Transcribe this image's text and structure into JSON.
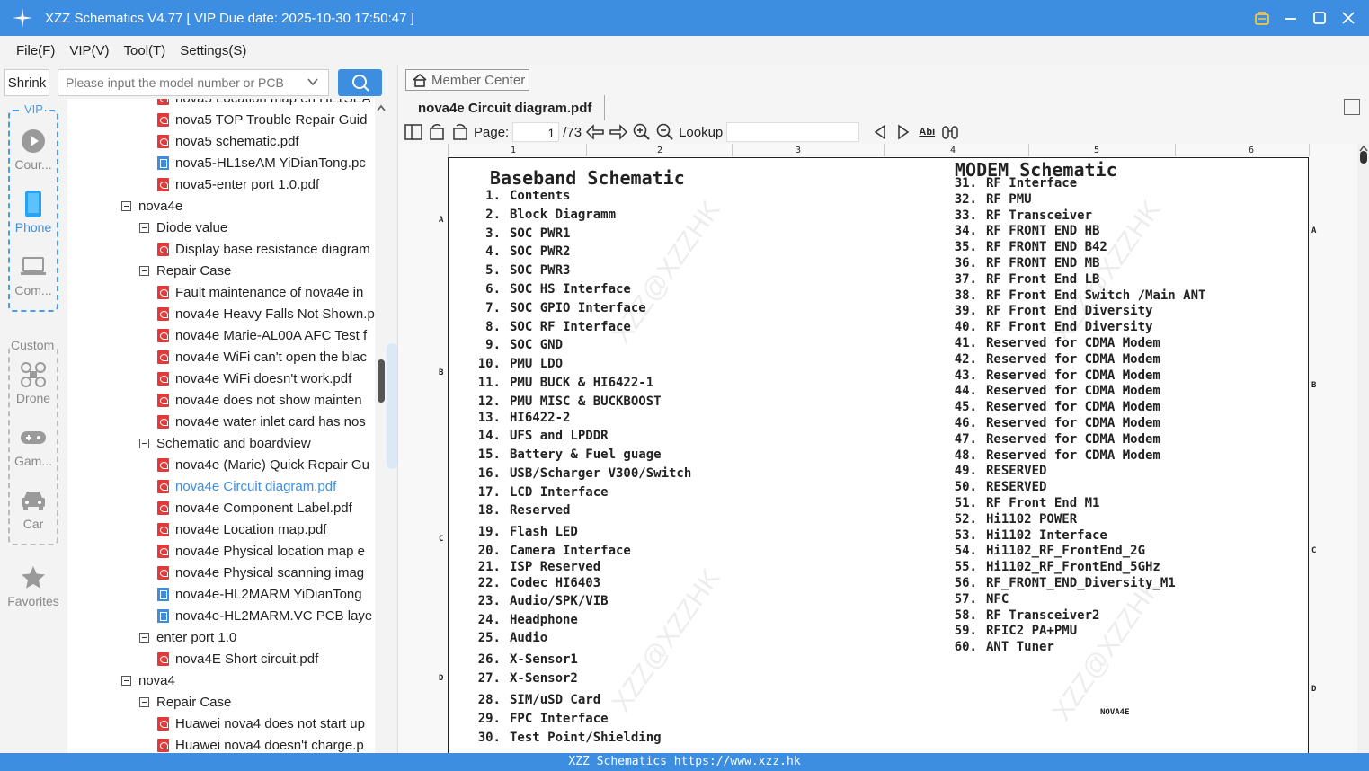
{
  "window": {
    "title": "XZZ Schematics V4.77 [ VIP Due date: 2025-10-30 17:50:47 ]"
  },
  "menu": [
    "File(F)",
    "VIP(V)",
    "Tool(T)",
    "Settings(S)"
  ],
  "left": {
    "shrink_label": "Shrink",
    "search_placeholder": "Please input the model number or PCB"
  },
  "sidebar": {
    "vip_caption": "VIP",
    "custom_caption": "Custom",
    "items": [
      {
        "label": "Cour...",
        "icon": "play-icon"
      },
      {
        "label": "Phone",
        "icon": "phone-icon"
      },
      {
        "label": "Com...",
        "icon": "laptop-icon"
      },
      {
        "label": "Drone",
        "icon": "drone-icon"
      },
      {
        "label": "Gam...",
        "icon": "gamepad-icon"
      },
      {
        "label": "Car",
        "icon": "car-icon"
      },
      {
        "label": "Favorites",
        "icon": "star-icon"
      }
    ]
  },
  "tree": [
    {
      "label": "nova5 Location map en HL1SEA",
      "type": "pdf",
      "level": 3
    },
    {
      "label": "nova5 TOP Trouble Repair Guid",
      "type": "pdf",
      "level": 3
    },
    {
      "label": "nova5 schematic.pdf",
      "type": "pdf",
      "level": 3
    },
    {
      "label": "nova5-HL1seAM YiDianTong.pc",
      "type": "pcb",
      "level": 3
    },
    {
      "label": "nova5-enter port 1.0.pdf",
      "type": "pdf",
      "level": 3
    },
    {
      "label": "nova4e",
      "type": "folder",
      "level": 1
    },
    {
      "label": "Diode value",
      "type": "folder",
      "level": 2
    },
    {
      "label": "Display base resistance diagram",
      "type": "pdf",
      "level": 3
    },
    {
      "label": "Repair Case",
      "type": "folder",
      "level": 2
    },
    {
      "label": "Fault maintenance of nova4e in",
      "type": "pdf",
      "level": 3
    },
    {
      "label": "nova4e Heavy Falls Not Shown.p",
      "type": "pdf",
      "level": 3
    },
    {
      "label": "nova4e Marie-AL00A AFC Test f",
      "type": "pdf",
      "level": 3
    },
    {
      "label": "nova4e WiFi can't open the blac",
      "type": "pdf",
      "level": 3
    },
    {
      "label": "nova4e WiFi doesn't work.pdf",
      "type": "pdf",
      "level": 3
    },
    {
      "label": "nova4e does not show mainten",
      "type": "pdf",
      "level": 3
    },
    {
      "label": "nova4e water inlet card has nos",
      "type": "pdf",
      "level": 3
    },
    {
      "label": "Schematic and boardview",
      "type": "folder",
      "level": 2
    },
    {
      "label": "nova4e (Marie) Quick Repair Gu",
      "type": "pdf",
      "level": 3
    },
    {
      "label": "nova4e Circuit diagram.pdf",
      "type": "pdf",
      "level": 3,
      "selected": true
    },
    {
      "label": "nova4e Component Label.pdf",
      "type": "pdf",
      "level": 3
    },
    {
      "label": "nova4e Location map.pdf",
      "type": "pdf",
      "level": 3
    },
    {
      "label": "nova4e Physical location map e",
      "type": "pdf",
      "level": 3
    },
    {
      "label": "nova4e Physical scanning imag",
      "type": "pdf",
      "level": 3
    },
    {
      "label": "nova4e-HL2MARM YiDianTong",
      "type": "pcb",
      "level": 3
    },
    {
      "label": "nova4e-HL2MARM.VC PCB laye",
      "type": "pcb",
      "level": 3
    },
    {
      "label": "enter port 1.0",
      "type": "folder",
      "level": 2
    },
    {
      "label": "nova4E Short circuit.pdf",
      "type": "pdf",
      "level": 3
    },
    {
      "label": "nova4",
      "type": "folder",
      "level": 1
    },
    {
      "label": "Repair Case",
      "type": "folder",
      "level": 2
    },
    {
      "label": "Huawei nova4 does not start up",
      "type": "pdf",
      "level": 3
    },
    {
      "label": "Huawei nova4 doesn't charge.p",
      "type": "pdf",
      "level": 3
    }
  ],
  "right": {
    "member_center": "Member Center",
    "doc_tab": "nova4e Circuit diagram.pdf",
    "page_label": "Page:",
    "page_value": "1",
    "page_total": "/73",
    "lookup_label": "Lookup",
    "abi_label": "Abi"
  },
  "doc": {
    "ruler": [
      "1",
      "2",
      "3",
      "4",
      "5",
      "6"
    ],
    "rows": [
      "A",
      "B",
      "C",
      "D"
    ],
    "left_title": "Baseband Schematic",
    "right_title": "MODEM Schematic",
    "left_entries": [
      [
        "1.",
        "Contents"
      ],
      [
        "2.",
        "Block Diagramm"
      ],
      [
        "3.",
        "SOC PWR1"
      ],
      [
        "4.",
        "SOC PWR2"
      ],
      [
        "5.",
        "SOC PWR3"
      ],
      [
        "6.",
        "SOC HS Interface"
      ],
      [
        "7.",
        "SOC GPIO Interface"
      ],
      [
        "8.",
        "SOC RF Interface"
      ],
      [
        "9.",
        "SOC GND"
      ],
      [
        "10.",
        "PMU LDO"
      ],
      [
        "11.",
        "PMU BUCK & HI6422-1"
      ],
      [
        "12.",
        "PMU MISC & BUCKBOOST"
      ],
      [
        "13.",
        "HI6422-2"
      ],
      [
        "14.",
        "UFS and LPDDR"
      ],
      [
        "15.",
        "Battery & Fuel guage"
      ],
      [
        "16.",
        "USB/Scharger V300/Switch"
      ],
      [
        "17.",
        "LCD Interface"
      ],
      [
        "18.",
        "Reserved"
      ],
      [
        "19.",
        "Flash LED"
      ],
      [
        "20.",
        "Camera Interface"
      ],
      [
        "21.",
        "ISP Reserved"
      ],
      [
        "22.",
        "Codec HI6403"
      ],
      [
        "23.",
        "Audio/SPK/VIB"
      ],
      [
        "24.",
        "Headphone"
      ],
      [
        "25.",
        "Audio"
      ],
      [
        "26.",
        "X-Sensor1"
      ],
      [
        "27.",
        "X-Sensor2"
      ],
      [
        "28.",
        "SIM/uSD Card"
      ],
      [
        "29.",
        "FPC Interface"
      ],
      [
        "30.",
        "Test Point/Shielding"
      ]
    ],
    "right_entries": [
      [
        "31.",
        "RF Interface"
      ],
      [
        "32.",
        "RF PMU"
      ],
      [
        "33.",
        "RF Transceiver"
      ],
      [
        "34.",
        "RF FRONT END HB"
      ],
      [
        "35.",
        "RF FRONT END B42"
      ],
      [
        "36.",
        "RF FRONT END MB"
      ],
      [
        "37.",
        "RF Front End LB"
      ],
      [
        "38.",
        "RF Front End Switch /Main ANT"
      ],
      [
        "39.",
        "RF Front End Diversity"
      ],
      [
        "40.",
        "RF Front End Diversity"
      ],
      [
        "41.",
        "Reserved for CDMA Modem"
      ],
      [
        "42.",
        "Reserved for CDMA Modem"
      ],
      [
        "43.",
        "Reserved for CDMA Modem"
      ],
      [
        "44.",
        "Reserved for CDMA Modem"
      ],
      [
        "45.",
        "Reserved for CDMA Modem"
      ],
      [
        "46.",
        "Reserved for CDMA Modem"
      ],
      [
        "47.",
        "Reserved for CDMA Modem"
      ],
      [
        "48.",
        "Reserved for CDMA Modem"
      ],
      [
        "49.",
        "RESERVED"
      ],
      [
        "50.",
        "RESERVED"
      ],
      [
        "51.",
        "RF Front End M1"
      ],
      [
        "52.",
        "Hi1102 POWER"
      ],
      [
        "53.",
        "Hi1102 Interface"
      ],
      [
        "54.",
        "Hi1102_RF_FrontEnd_2G"
      ],
      [
        "55.",
        "Hi1102_RF_FrontEnd_5GHz"
      ],
      [
        "56.",
        "RF_FRONT_END_Diversity_M1"
      ],
      [
        "57.",
        "NFC"
      ],
      [
        "58.",
        "RF Transceiver2"
      ],
      [
        "59.",
        "RFIC2 PA+PMU"
      ],
      [
        "60.",
        "ANT Tuner"
      ]
    ],
    "footnote": "NOVA4E",
    "watermark": "XZZ@XZZHK"
  },
  "status": "XZZ Schematics https://www.xzz.hk"
}
